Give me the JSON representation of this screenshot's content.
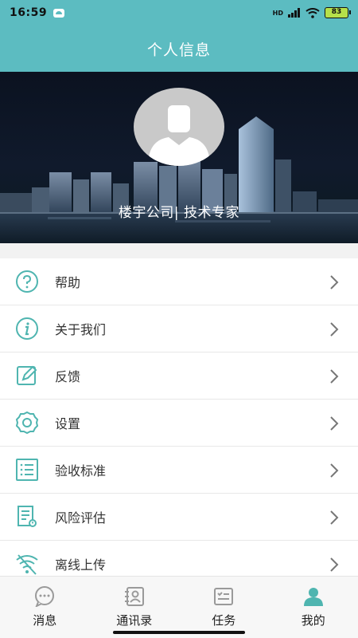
{
  "status_bar": {
    "time": "16:59",
    "network": "HD",
    "battery": "83"
  },
  "header": {
    "title": "个人信息"
  },
  "profile": {
    "name": "楼宇公司| 技术专家"
  },
  "menu": [
    {
      "label": "帮助",
      "icon": "help-icon"
    },
    {
      "label": "关于我们",
      "icon": "info-icon"
    },
    {
      "label": "反馈",
      "icon": "feedback-icon"
    },
    {
      "label": "设置",
      "icon": "settings-icon"
    },
    {
      "label": "验收标准",
      "icon": "list-icon"
    },
    {
      "label": "风险评估",
      "icon": "document-icon"
    },
    {
      "label": "离线上传",
      "icon": "wifi-icon"
    }
  ],
  "tabs": [
    {
      "label": "消息",
      "icon": "message-icon",
      "active": false
    },
    {
      "label": "通讯录",
      "icon": "contacts-icon",
      "active": false
    },
    {
      "label": "任务",
      "icon": "task-icon",
      "active": false
    },
    {
      "label": "我的",
      "icon": "profile-icon",
      "active": true
    }
  ],
  "colors": {
    "accent": "#5cbcc1",
    "icon_teal": "#4fb5b0",
    "tab_inactive": "#9a9a9a"
  }
}
